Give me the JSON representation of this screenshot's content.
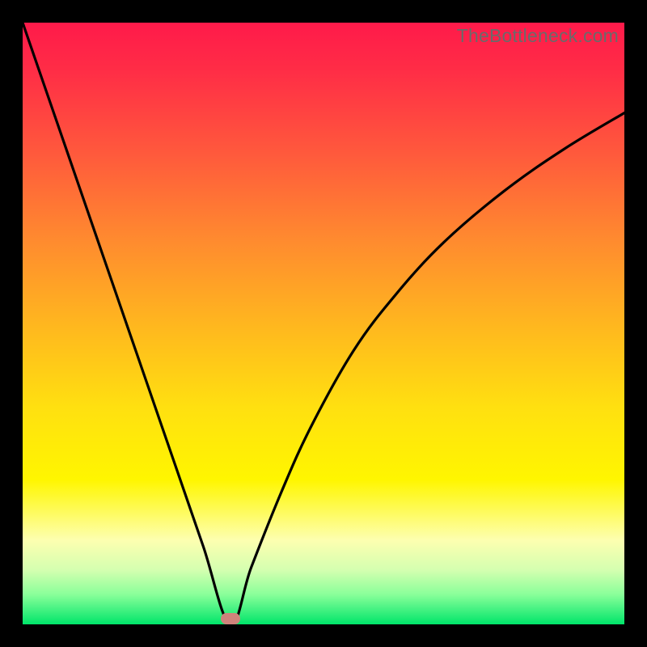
{
  "watermark": {
    "text": "TheBottleneck.com"
  },
  "chart_data": {
    "type": "line",
    "title": "",
    "xlabel": "",
    "ylabel": "",
    "xlim": [
      0,
      1
    ],
    "ylim": [
      0,
      1
    ],
    "optimal_x": 0.345,
    "series": [
      {
        "name": "bottleneck-curve",
        "x": [
          0.0,
          0.05,
          0.1,
          0.15,
          0.2,
          0.25,
          0.3,
          0.345,
          0.38,
          0.43,
          0.48,
          0.55,
          0.62,
          0.7,
          0.8,
          0.9,
          1.0
        ],
        "y": [
          1.0,
          0.855,
          0.71,
          0.565,
          0.42,
          0.275,
          0.13,
          0.0,
          0.095,
          0.22,
          0.33,
          0.455,
          0.548,
          0.635,
          0.72,
          0.79,
          0.85
        ]
      }
    ],
    "marker": {
      "x": 0.345,
      "y": 0.01
    },
    "background_gradient": {
      "top_color": "#ff1a4a",
      "bottom_color": "#00e56a"
    }
  }
}
